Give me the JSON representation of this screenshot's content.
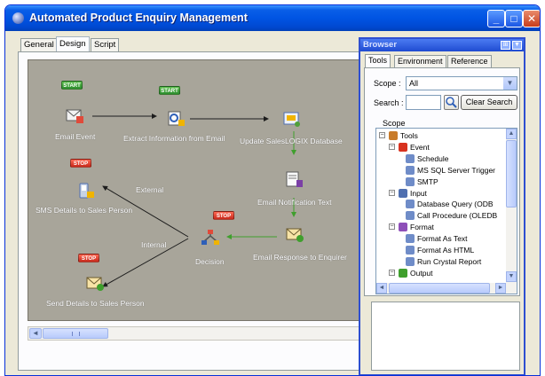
{
  "window": {
    "title": "Automated Product Enquiry Management",
    "controls": {
      "minimize": "_",
      "maximize": "□",
      "close": "✕"
    }
  },
  "designer": {
    "tabs": [
      "General",
      "Design",
      "Script"
    ],
    "active_tab": "Design",
    "badges": {
      "start": "START",
      "stop": "STOP"
    },
    "nodes": {
      "email_event": "Email Event",
      "extract": "Extract Information from Email",
      "update_db": "Update SalesLOGIX Database",
      "email_notification": "Email Notification Text",
      "email_response": "Email Response to Enquirer",
      "decision": "Decision",
      "sms": "SMS Details to Sales Person",
      "send_details": "Send Details to Sales Person"
    },
    "edge_labels": {
      "external": "External",
      "internal": "Internal"
    },
    "scroll_grip": "|||"
  },
  "browser": {
    "title": "Browser",
    "tabs": [
      "Tools",
      "Environment",
      "Reference"
    ],
    "active_tab": "Tools",
    "scope_label": "Scope :",
    "scope_value": "All",
    "search_label": "Search :",
    "search_value": "",
    "clear_search": "Clear Search",
    "tree_header": "Scope",
    "tree": [
      {
        "label": "Tools",
        "level": 0,
        "expander": "−",
        "icon": "tools-icon"
      },
      {
        "label": "Event",
        "level": 1,
        "expander": "−",
        "icon": "event-icon"
      },
      {
        "label": "Schedule",
        "level": 2,
        "icon": "schedule-icon"
      },
      {
        "label": "MS SQL Server Trigger",
        "level": 2,
        "icon": "sql-trigger-icon"
      },
      {
        "label": "SMTP",
        "level": 2,
        "icon": "smtp-icon"
      },
      {
        "label": "Input",
        "level": 1,
        "expander": "−",
        "icon": "input-icon"
      },
      {
        "label": "Database Query (ODB",
        "level": 2,
        "icon": "db-query-icon"
      },
      {
        "label": "Call Procedure (OLEDB",
        "level": 2,
        "icon": "call-procedure-icon"
      },
      {
        "label": "Format",
        "level": 1,
        "expander": "−",
        "icon": "format-icon"
      },
      {
        "label": "Format As Text",
        "level": 2,
        "icon": "format-text-icon"
      },
      {
        "label": "Format As HTML",
        "level": 2,
        "icon": "format-html-icon"
      },
      {
        "label": "Run Crystal Report",
        "level": 2,
        "icon": "crystal-report-icon"
      },
      {
        "label": "Output",
        "level": 1,
        "expander": "−",
        "icon": "output-icon"
      }
    ]
  },
  "colors": {
    "xp_blue": "#0054e3",
    "canvas": "#a8a59a",
    "start": "#3aa33a",
    "stop": "#d8321f"
  }
}
